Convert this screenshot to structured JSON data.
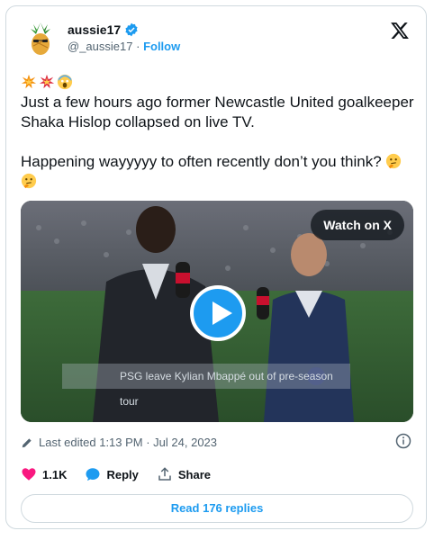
{
  "author": {
    "display_name": "aussie17",
    "handle": "@_aussie17",
    "separator": "·",
    "follow_label": "Follow"
  },
  "tweet": {
    "emoji_line": [
      "collision",
      "collision",
      "screaming-face"
    ],
    "line1": "Just a few hours ago former Newcastle United goalkeeper Shaka Hislop collapsed on live TV.",
    "line2": "Happening wayyyyy to often recently don’t you think?",
    "line2_emojis": [
      "thinking-face",
      "thinking-face"
    ]
  },
  "media": {
    "watch_label": "Watch on X",
    "ticker_text": "PSG leave Kylian Mbappé out of pre-season tour"
  },
  "meta": {
    "edited_text": "Last edited 1:13 PM · Jul 24, 2023"
  },
  "actions": {
    "likes": "1.1K",
    "reply_label": "Reply",
    "share_label": "Share"
  },
  "replies_button": "Read 176 replies",
  "colors": {
    "accent": "#1d9bf0",
    "like": "#f91880",
    "muted": "#536471"
  }
}
